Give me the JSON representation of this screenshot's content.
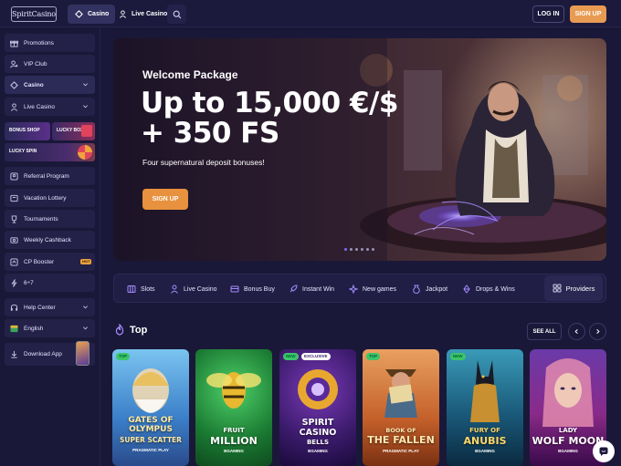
{
  "header": {
    "logo_text": "SpiritCasino",
    "nav": [
      {
        "label": "Casino"
      },
      {
        "label": "Live Casino"
      }
    ],
    "login_label": "LOG IN",
    "signup_label": "SIGN UP"
  },
  "sidebar": {
    "items": [
      {
        "label": "Promotions",
        "icon": "gift-icon"
      },
      {
        "label": "VIP Club",
        "icon": "user-star-icon"
      },
      {
        "label": "Casino",
        "icon": "spade-icon"
      },
      {
        "label": "Live Casino",
        "icon": "dealer-icon"
      },
      {
        "label": "Referral Program",
        "icon": "referral-icon"
      },
      {
        "label": "Vacation Lottery",
        "icon": "ticket-icon"
      },
      {
        "label": "Tournaments",
        "icon": "trophy-icon"
      },
      {
        "label": "Weekly Cashback",
        "icon": "cashback-icon"
      },
      {
        "label": "CP Booster",
        "icon": "booster-icon",
        "badge": "HOT"
      },
      {
        "label": "6÷7",
        "icon": "bolt-icon"
      },
      {
        "label": "Help Center",
        "icon": "help-icon"
      },
      {
        "label": "English",
        "icon": "flag-icon"
      },
      {
        "label": "Download App",
        "icon": "download-icon"
      }
    ],
    "promo_tiles": [
      {
        "label": "BONUS SHOP"
      },
      {
        "label": "LUCKY BOX"
      },
      {
        "label": "LUCKY SPIN"
      }
    ]
  },
  "banner": {
    "subtitle": "Welcome Package",
    "headline_line1": "Up to 15,000 €/$",
    "headline_line2": "+ 350 FS",
    "description": "Four supernatural deposit bonuses!",
    "cta": "SIGN UP",
    "slide_count": 6,
    "active_slide": 0
  },
  "categories": [
    {
      "label": "Slots",
      "icon": "slots-icon"
    },
    {
      "label": "Live Casino",
      "icon": "live-icon"
    },
    {
      "label": "Bonus Buy",
      "icon": "bonus-buy-icon"
    },
    {
      "label": "Instant Win",
      "icon": "rocket-icon"
    },
    {
      "label": "New games",
      "icon": "sparkle-icon"
    },
    {
      "label": "Jackpot",
      "icon": "jackpot-icon"
    },
    {
      "label": "Drops & Wins",
      "icon": "drops-icon"
    }
  ],
  "providers_label": "Providers",
  "top_section": {
    "title": "Top",
    "see_all": "SEE ALL"
  },
  "games": [
    {
      "line1": "GATES OF OLYMPUS",
      "line2": "SUPER SCATTER",
      "provider": "PRAGMATIC PLAY",
      "badges": [
        "TOP"
      ],
      "bg": "#5aa8e0"
    },
    {
      "line1": "FRUIT",
      "line2": "MILLION",
      "provider": "BGAMING",
      "badges": [],
      "bg": "#1f8a3a"
    },
    {
      "line1": "SPIRIT CASINO",
      "line2": "BELLS",
      "provider": "BGAMING",
      "badges": [
        "NEW",
        "EXCLUSIVE"
      ],
      "bg": "#3b1d72"
    },
    {
      "line1": "BOOK OF",
      "line2": "THE FALLEN",
      "provider": "PRAGMATIC PLAY",
      "badges": [
        "TOP"
      ],
      "bg": "#c86a2a"
    },
    {
      "line1": "FURY OF",
      "line2": "ANUBIS",
      "provider": "BGAMING",
      "badges": [
        "NEW"
      ],
      "bg": "#1d6f8a"
    },
    {
      "line1": "LADY",
      "line2": "WOLF MOON",
      "provider": "BGAMING",
      "badges": [],
      "bg": "#6a2a8a"
    }
  ]
}
